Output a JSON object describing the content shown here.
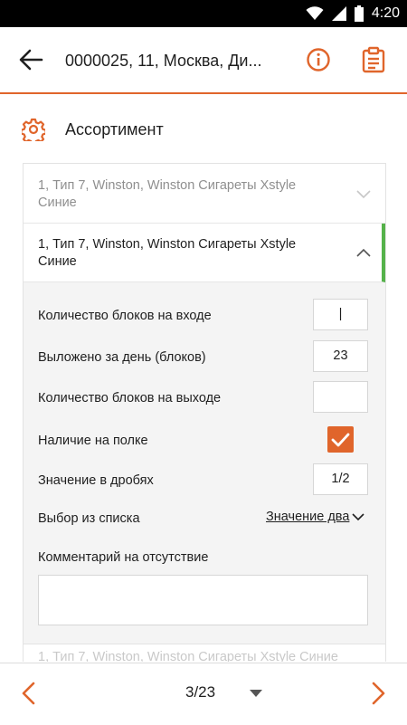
{
  "status_bar": {
    "time": "4:20"
  },
  "app_bar": {
    "title": "0000025, 11, Москва, Ди..."
  },
  "section": {
    "label": "Ассортимент"
  },
  "items": {
    "collapsed_label": "1, Тип 7, Winston, Winston Сигареты Xstyle Синие",
    "expanded_label": "1, Тип 7, Winston, Winston Сигареты Xstyle Синие",
    "next_label": "1, Тип 7, Winston, Winston Сигареты Xstyle Синие"
  },
  "form": {
    "blocks_in_label": "Количество блоков на входе",
    "blocks_in_value": "|",
    "laid_out_label": "Выложено за день (блоков)",
    "laid_out_value": "23",
    "blocks_out_label": "Количество блоков на выходе",
    "blocks_out_value": "",
    "on_shelf_label": "Наличие на полке",
    "on_shelf_checked": true,
    "fraction_label": "Значение в дробях",
    "fraction_value": "1/2",
    "select_label": "Выбор из списка",
    "select_value": "Значение два",
    "comment_label": "Комментарий на отсутствие",
    "comment_value": ""
  },
  "pager": {
    "counter": "3/23"
  },
  "colors": {
    "accent": "#e0652b",
    "active_marker": "#55b24a"
  }
}
